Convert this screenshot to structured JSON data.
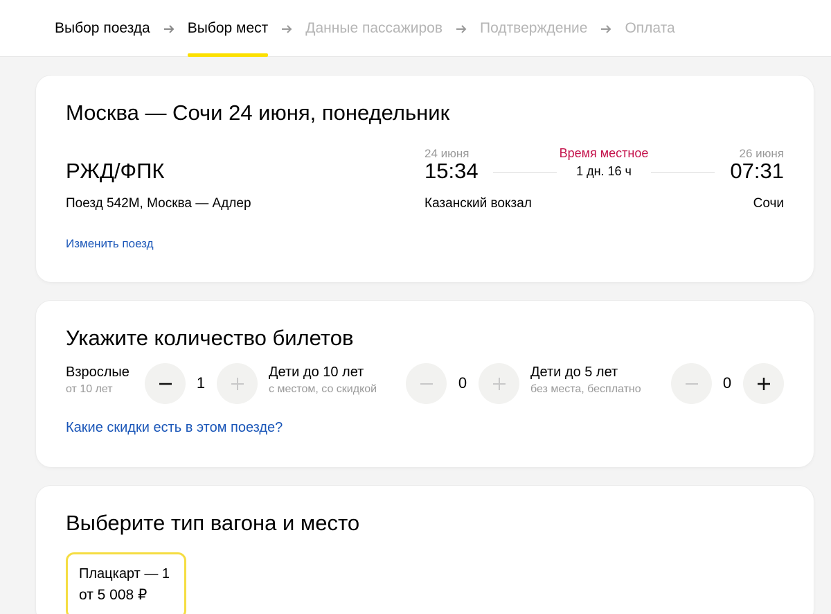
{
  "steps": [
    {
      "label": "Выбор поезда",
      "state": "done"
    },
    {
      "label": "Выбор мест",
      "state": "active"
    },
    {
      "label": "Данные пассажиров",
      "state": "inactive"
    },
    {
      "label": "Подтверждение",
      "state": "inactive"
    },
    {
      "label": "Оплата",
      "state": "inactive"
    }
  ],
  "trip": {
    "title": "Москва — Сочи 24 июня, понедельник",
    "carrier": "РЖД/ФПК",
    "train": "Поезд 542М, Москва — Адлер",
    "change_link": "Изменить поезд",
    "departure": {
      "date": "24 июня",
      "time": "15:34",
      "station": "Казанский вокзал"
    },
    "arrival": {
      "date": "26 июня",
      "time": "07:31",
      "station": "Сочи"
    },
    "local_time_note": "Время местное",
    "duration": "1 дн. 16 ч"
  },
  "tickets": {
    "title": "Укажите количество билетов",
    "groups": [
      {
        "label": "Взрослые",
        "sub": "от 10 лет",
        "count": "1"
      },
      {
        "label": "Дети до 10 лет",
        "sub": "с местом, со скидкой",
        "count": "0"
      },
      {
        "label": "Дети до 5 лет",
        "sub": "без места, бесплатно",
        "count": "0"
      }
    ],
    "discount_link": "Какие скидки есть в этом поезде?"
  },
  "car": {
    "title": "Выберите тип вагона и место",
    "options": [
      {
        "name": "Плацкарт — 1",
        "price": "от 5 008 ₽"
      }
    ]
  },
  "colors": {
    "accent": "#fce000",
    "link": "#1a56b8",
    "local_time": "#c4124b"
  }
}
